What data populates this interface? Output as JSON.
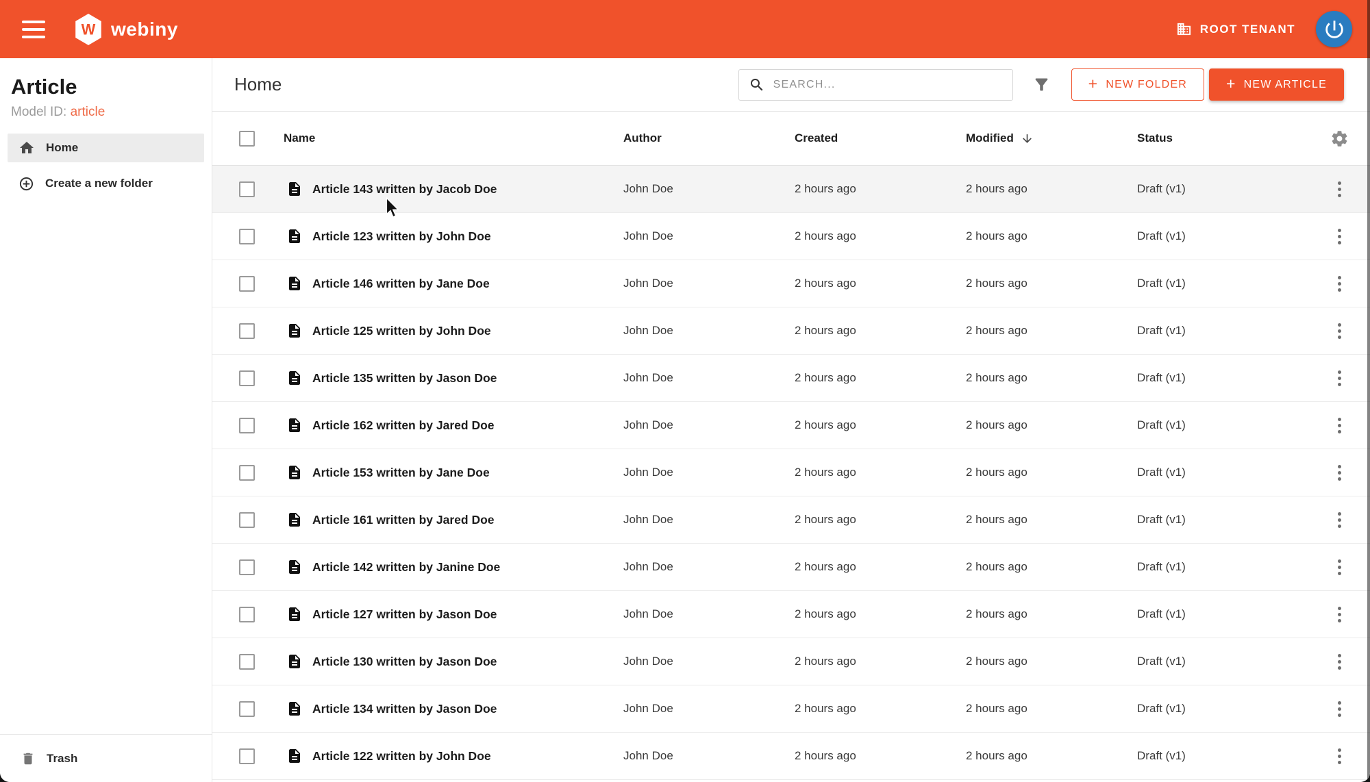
{
  "colors": {
    "accent": "#f0522b",
    "accent_light": "#ef6b48",
    "avatar_blue": "#2a7cc0"
  },
  "app_bar": {
    "logo_text": "webiny",
    "logo_letter": "W",
    "tenant_label": "ROOT TENANT"
  },
  "sidebar": {
    "title": "Article",
    "model_id_label": "Model ID: ",
    "model_id_value": "article",
    "nav": [
      {
        "label": "Home",
        "selected": true
      },
      {
        "label": "Create a new folder"
      }
    ],
    "trash_label": "Trash"
  },
  "toolbar": {
    "title": "Home",
    "search_placeholder": "SEARCH...",
    "plus_glyph": "+",
    "new_folder_label": "NEW FOLDER",
    "new_article_label": "NEW ARTICLE"
  },
  "table": {
    "columns": [
      "Name",
      "Author",
      "Created",
      "Modified",
      "Status"
    ],
    "sort": {
      "column": "Modified",
      "direction": "desc"
    },
    "rows": [
      {
        "name": "Article 143 written by Jacob Doe",
        "author": "John Doe",
        "created": "2 hours ago",
        "modified": "2 hours ago",
        "status": "Draft (v1)",
        "hovered": true
      },
      {
        "name": "Article 123 written by John Doe",
        "author": "John Doe",
        "created": "2 hours ago",
        "modified": "2 hours ago",
        "status": "Draft (v1)"
      },
      {
        "name": "Article 146 written by Jane Doe",
        "author": "John Doe",
        "created": "2 hours ago",
        "modified": "2 hours ago",
        "status": "Draft (v1)"
      },
      {
        "name": "Article 125 written by John Doe",
        "author": "John Doe",
        "created": "2 hours ago",
        "modified": "2 hours ago",
        "status": "Draft (v1)"
      },
      {
        "name": "Article 135 written by Jason Doe",
        "author": "John Doe",
        "created": "2 hours ago",
        "modified": "2 hours ago",
        "status": "Draft (v1)"
      },
      {
        "name": "Article 162 written by Jared Doe",
        "author": "John Doe",
        "created": "2 hours ago",
        "modified": "2 hours ago",
        "status": "Draft (v1)"
      },
      {
        "name": "Article 153 written by Jane Doe",
        "author": "John Doe",
        "created": "2 hours ago",
        "modified": "2 hours ago",
        "status": "Draft (v1)"
      },
      {
        "name": "Article 161 written by Jared Doe",
        "author": "John Doe",
        "created": "2 hours ago",
        "modified": "2 hours ago",
        "status": "Draft (v1)"
      },
      {
        "name": "Article 142 written by Janine Doe",
        "author": "John Doe",
        "created": "2 hours ago",
        "modified": "2 hours ago",
        "status": "Draft (v1)"
      },
      {
        "name": "Article 127 written by Jason Doe",
        "author": "John Doe",
        "created": "2 hours ago",
        "modified": "2 hours ago",
        "status": "Draft (v1)"
      },
      {
        "name": "Article 130 written by Jason Doe",
        "author": "John Doe",
        "created": "2 hours ago",
        "modified": "2 hours ago",
        "status": "Draft (v1)"
      },
      {
        "name": "Article 134 written by Jason Doe",
        "author": "John Doe",
        "created": "2 hours ago",
        "modified": "2 hours ago",
        "status": "Draft (v1)"
      },
      {
        "name": "Article 122 written by John Doe",
        "author": "John Doe",
        "created": "2 hours ago",
        "modified": "2 hours ago",
        "status": "Draft (v1)"
      }
    ]
  }
}
